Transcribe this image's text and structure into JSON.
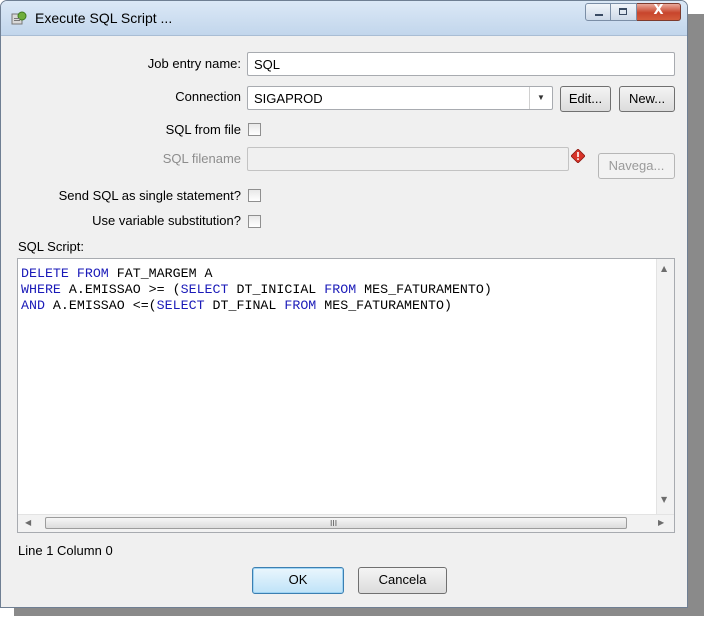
{
  "window": {
    "title": "Execute SQL Script ...",
    "close_glyph": "X"
  },
  "form": {
    "job_entry_label": "Job entry name:",
    "job_entry_value": "SQL",
    "connection_label": "Connection",
    "connection_value": "SIGAPROD",
    "edit_button": "Edit...",
    "new_button": "New...",
    "sql_from_file_label": "SQL from file",
    "sql_filename_label": "SQL filename",
    "sql_filename_value": "",
    "browse_button": "Navega...",
    "single_statement_label": "Send SQL as single statement?",
    "variable_substitution_label": "Use variable substitution?",
    "sql_script_label": "SQL Script:"
  },
  "editor": {
    "line1": {
      "kw1": "DELETE FROM",
      "rest": " FAT_MARGEM A"
    },
    "line2": {
      "kw1": "WHERE",
      "t1": " A.EMISSAO >= (",
      "kw2": "SELECT",
      "t2": " DT_INICIAL ",
      "kw3": "FROM",
      "t3": " MES_FATURAMENTO)"
    },
    "line3": {
      "kw1": "AND",
      "t1": " A.EMISSAO <=(",
      "kw2": "SELECT",
      "t2": " DT_FINAL ",
      "kw3": "FROM",
      "t3": " MES_FATURAMENTO)"
    },
    "hscroll_grip": "III"
  },
  "status": {
    "position": "Line 1 Column 0"
  },
  "buttons": {
    "ok": "OK",
    "cancel": "Cancela"
  },
  "colors": {
    "keyword": "#1a1ab8",
    "window_bg": "#f0f0f0",
    "titlebar": "#c2d6ec"
  }
}
